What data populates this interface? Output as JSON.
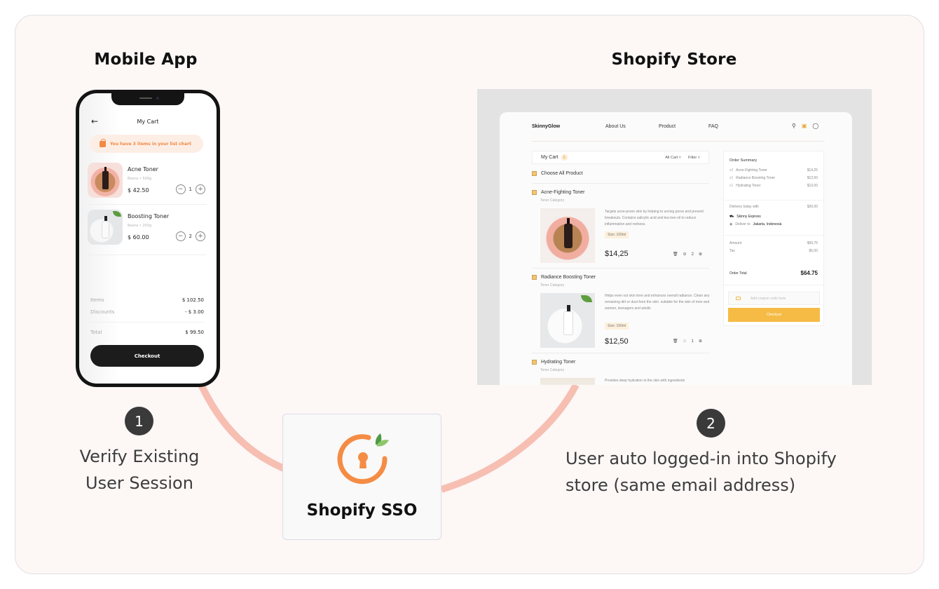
{
  "titles": {
    "mobile": "Mobile App",
    "store": "Shopify Store"
  },
  "colors": {
    "wire": "#f4b5a6",
    "accent_orange": "#f58c45",
    "leaf_green": "#6db552",
    "store_checkout": "#f5bb45",
    "step_badge": "#3a3a3a"
  },
  "mobile": {
    "header_title": "My Cart",
    "back_icon": "arrow-left-icon",
    "banner": "You have 3 items in your list chart",
    "items": [
      {
        "name": "Acne Toner",
        "meta": "Beans  •  500g",
        "price": "$ 42.50",
        "qty": "1"
      },
      {
        "name": "Boosting Toner",
        "meta": "Beans  •  250g",
        "price": "$ 60.00",
        "qty": "2"
      }
    ],
    "summary": {
      "items_label": "Items",
      "items_value": "$ 102.50",
      "discounts_label": "Discounts",
      "discounts_value": "- $ 3.00",
      "total_label": "Total",
      "total_value": "$ 99.50"
    },
    "checkout": "Checkout",
    "minus": "−",
    "plus": "+"
  },
  "store": {
    "logo": "SkinnyGlow",
    "nav": [
      "About Us",
      "Product",
      "FAQ"
    ],
    "icons": [
      "search-icon",
      "bag-icon",
      "user-icon"
    ],
    "cart_title": "My Cart",
    "cart_count": "3",
    "all_cart": "All Cart ˅",
    "filter": "Filter ˅",
    "choose_all": "Choose All Product",
    "products": [
      {
        "name": "Acne-Fighting Toner",
        "category": "Toner Category",
        "desc": "Targets acne-prone skin by helping to unclog pores and prevent breakouts. Contains salicylic acid and tea tree oil to reduce inflammation and redness.",
        "size": "Size: 100ml",
        "price": "$14,25",
        "qty": "2"
      },
      {
        "name": "Radiance Boosting Toner",
        "category": "Toner Category",
        "desc": "Helps even out skin tone and enhances overall radiance. Clean any remaining dirt or dust from the skin. suitable for the skin of men and women, teenagers and adults",
        "size": "Size: 100ml",
        "price": "$12,50",
        "qty": "1"
      },
      {
        "name": "Hydrating Toner",
        "category": "Toner Category",
        "desc": "Provides deep hydration to the skin with ingredients"
      }
    ],
    "summary": {
      "title": "Order Summary",
      "lines": [
        {
          "qty": "x2",
          "name": "Acne-Fighting Toner",
          "price": "$14,25"
        },
        {
          "qty": "x1",
          "name": "Radiance Boosting Toner",
          "price": "$12,50"
        },
        {
          "qty": "x1",
          "name": "Hydrating Toner",
          "price": "$13,00"
        }
      ],
      "delivery_label": "Delivery today with",
      "delivery_price": "$20,00",
      "courier": "Skinny Express",
      "deliver_to_prefix": "Deliver to",
      "deliver_to": "Jakarta, Indonesia",
      "amount_label": "Amount",
      "amount_value": "$59,75",
      "tax_label": "Tax",
      "tax_value": "$5,00",
      "total_label": "Order Total",
      "total_value": "$64.75",
      "coupon_placeholder": "Add coupon code here",
      "checkout": "Checkout"
    }
  },
  "steps": [
    {
      "number": "1",
      "text_line1": "Verify Existing",
      "text_line2": "User Session"
    },
    {
      "number": "2",
      "text_line1": "User auto logged-in into Shopify",
      "text_line2": "store (same email address)"
    }
  ],
  "sso": {
    "label": "Shopify SSO"
  }
}
